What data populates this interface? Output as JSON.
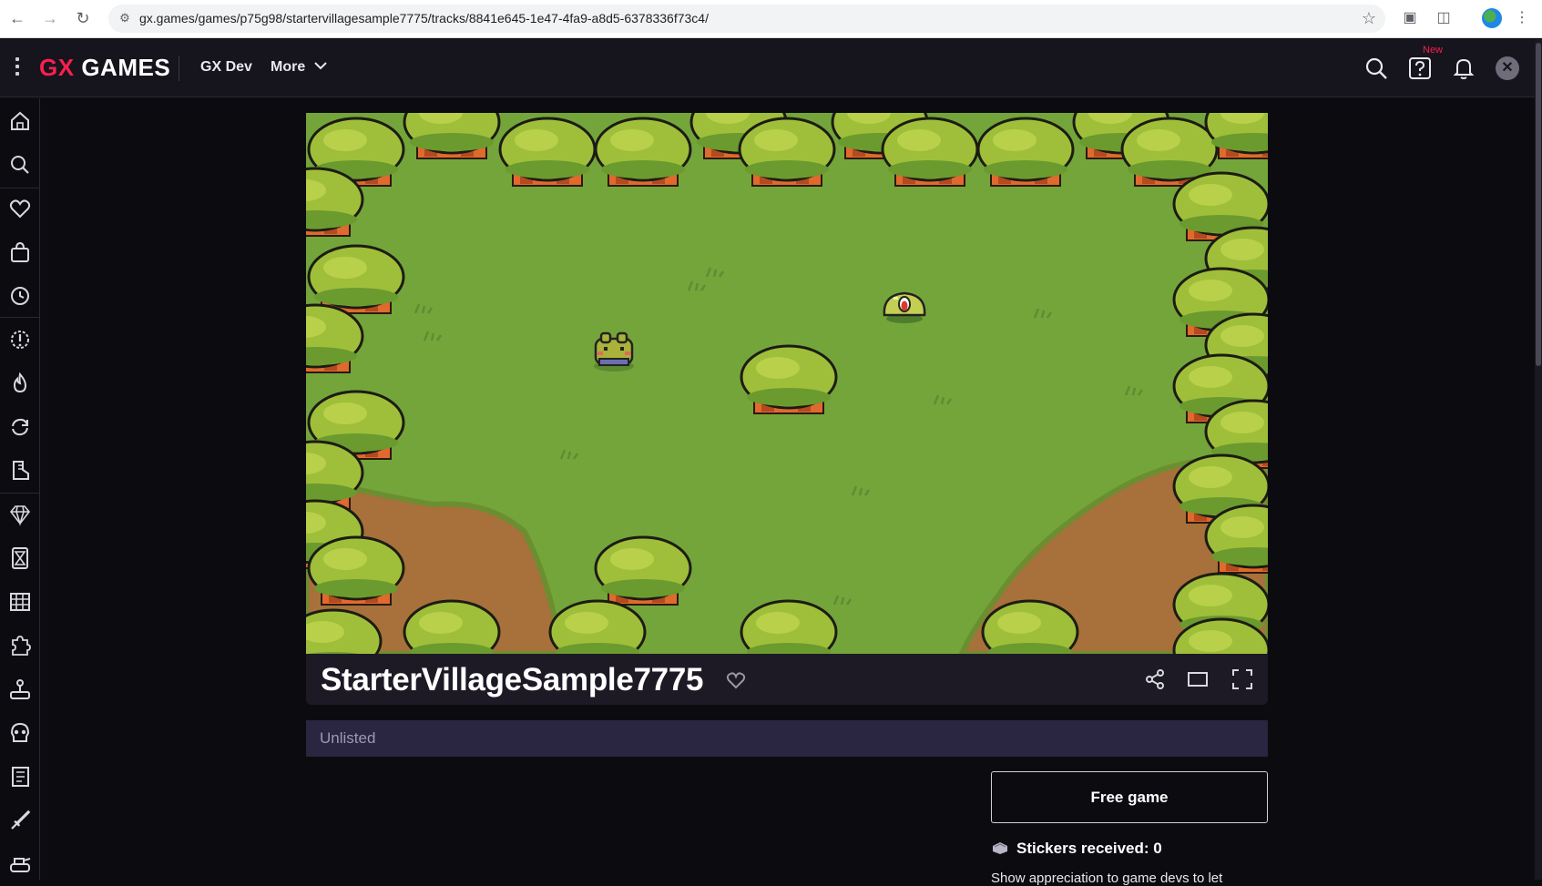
{
  "browser": {
    "url": "gx.games/games/p75g98/startervillagesample7775/tracks/8841e645-1e47-4fa9-a8d5-6378336f73c4/",
    "back_icon": "arrow-left-icon",
    "forward_icon": "arrow-right-icon",
    "reload_icon": "reload-icon",
    "bookmark_icon": "star-icon"
  },
  "header": {
    "logo_gx": "GX",
    "logo_games": "GAMES",
    "links": [
      "GX Dev",
      "More"
    ],
    "new_badge": "New",
    "accent_color": "#fa1e4e"
  },
  "sidebar": {
    "items": [
      "home-icon",
      "search-icon",
      "heart-icon",
      "bag-icon",
      "clock-icon",
      "alert-icon",
      "fire-icon",
      "refresh-icon",
      "boot-icon",
      "diamond-icon",
      "hourglass-icon",
      "grid-icon",
      "puzzle-icon",
      "joystick-icon",
      "skull-icon",
      "notebook-icon",
      "sword-icon",
      "tank-icon"
    ]
  },
  "game": {
    "title": "StarterVillageSample7775",
    "visibility": "Unlisted",
    "price_button": "Free game",
    "stickers_label": "Stickers received: 0",
    "appreciation_text": "Show appreciation to game devs to let"
  }
}
